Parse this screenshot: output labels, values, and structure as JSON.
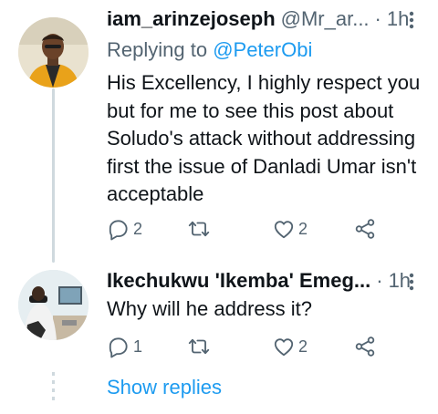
{
  "tweets": [
    {
      "username": "iam_arinzejoseph",
      "handle": "@Mr_ar...",
      "time": "1h",
      "replying_prefix": "Replying to ",
      "replying_to": "@PeterObi",
      "text": "His Excellency, I highly respect you but for me to see this post about Soludo's attack without addressing first the issue of Danladi Umar isn't acceptable",
      "replies": "2",
      "retweets": "",
      "likes": "2"
    },
    {
      "username": "Ikechukwu 'Ikemba' Emeg...",
      "handle": "",
      "time": "1h",
      "text": "Why will he address it?",
      "replies": "1",
      "retweets": "",
      "likes": "2"
    }
  ],
  "separator": "·",
  "show_replies_label": "Show replies",
  "icons": {
    "more": "more-vertical-icon",
    "reply": "comment-icon",
    "retweet": "retweet-icon",
    "like": "heart-icon",
    "share": "share-icon"
  },
  "colors": {
    "link": "#1d9bf0",
    "secondary": "#536471",
    "text": "#0f1419",
    "thread_line": "#cfd9de"
  }
}
